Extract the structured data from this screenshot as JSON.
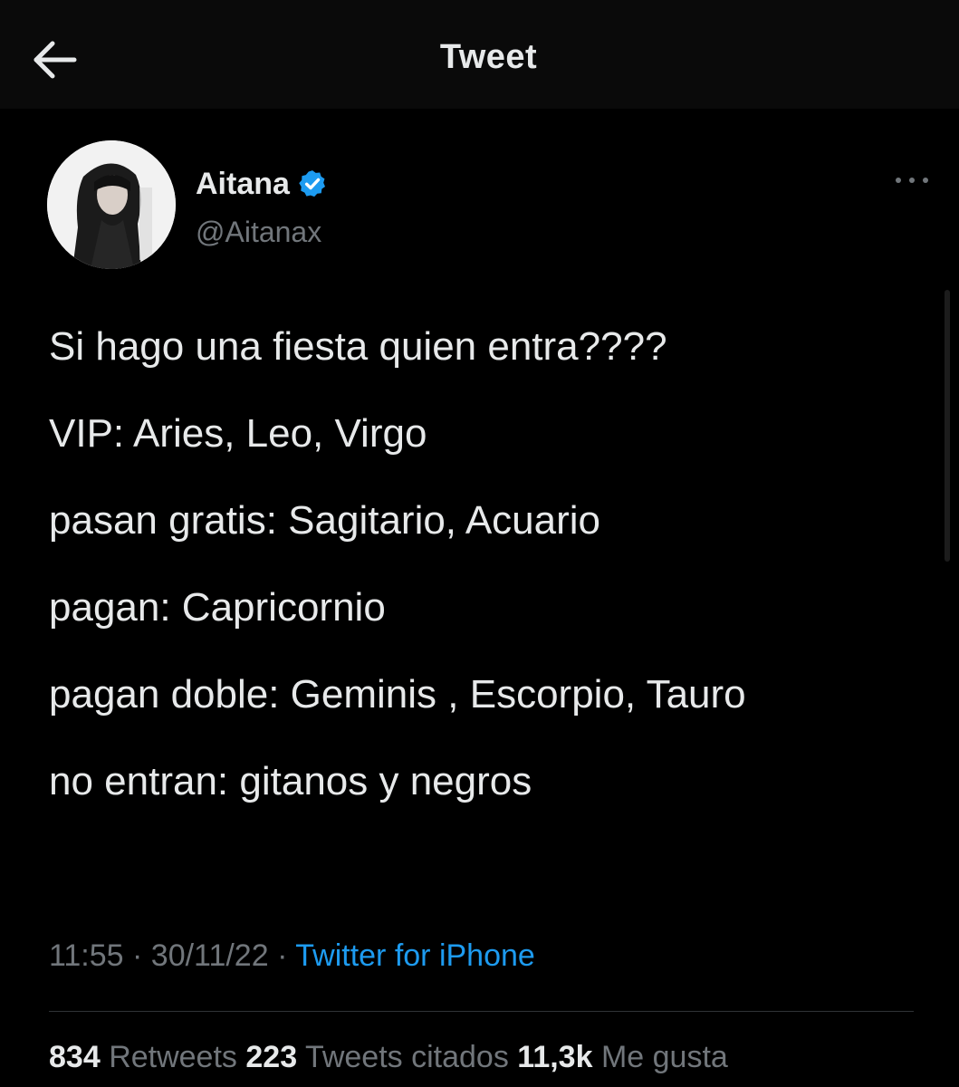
{
  "header": {
    "title": "Tweet",
    "back_icon": "arrow-left-icon"
  },
  "author": {
    "name": "Aitana",
    "handle": "@Aitanax",
    "verified": true,
    "verified_color": "#1d9bf0"
  },
  "tweet": {
    "lines": [
      "Si hago una fiesta quien entra????",
      "VIP: Aries, Leo, Virgo",
      "pasan gratis: Sagitario, Acuario",
      "pagan: Capricornio",
      "pagan doble: Geminis , Escorpio, Tauro",
      "no entran: gitanos y negros"
    ],
    "time": "11:55",
    "date": "30/11/22",
    "separator": "·",
    "source": "Twitter for iPhone"
  },
  "stats": {
    "retweets_count": "834",
    "retweets_label": "Retweets",
    "quotes_count": "223",
    "quotes_label": "Tweets citados",
    "likes_count": "11,3k",
    "likes_label": "Me gusta"
  },
  "colors": {
    "background": "#000000",
    "header_bg": "#0a0a0a",
    "text": "#e7e9ea",
    "muted": "#71767b",
    "accent": "#1d9bf0"
  }
}
